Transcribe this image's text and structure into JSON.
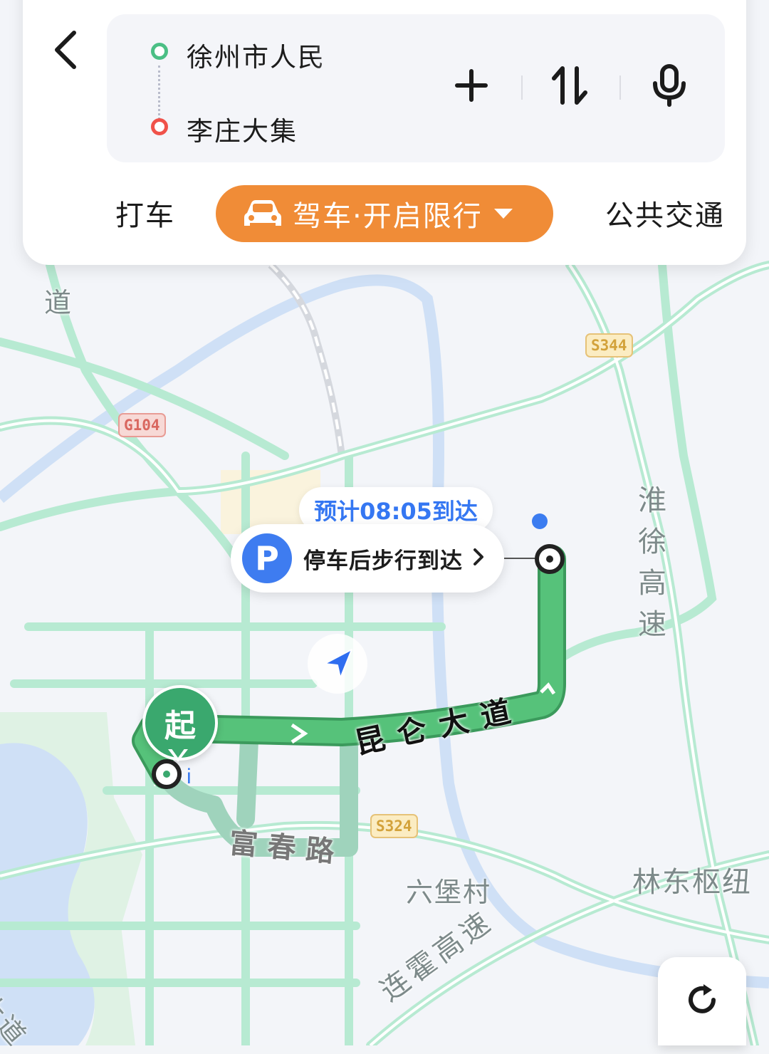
{
  "route": {
    "start": "徐州市人民",
    "end": "李庄大集"
  },
  "modes": {
    "taxi": "打车",
    "driving": "驾车·开启限行",
    "transit": "公共交通"
  },
  "icons": {
    "back": "chevron-left-icon",
    "add": "plus-icon",
    "swap": "swap-icon",
    "voice": "microphone-icon",
    "car": "car-icon",
    "dropdown": "caret-down-icon",
    "parking": "parking-icon",
    "locate": "navigation-arrow-icon",
    "refresh": "refresh-icon"
  },
  "map": {
    "eta": "预计08:05到达",
    "parking_label": "停车后步行到达",
    "parking_letter": "P",
    "start_marker": "起",
    "labels": {
      "kunlun": "昆仑大道",
      "fuchun": "富春路",
      "liubao": "六堡村",
      "huaixu": "淮徐高速",
      "lindong": "林东枢纽",
      "lianhuo": "连霍高速",
      "dao_top": "道",
      "dao_bottom": "大道"
    },
    "shields": {
      "g104": "G104",
      "s344": "S344",
      "s324": "S324"
    }
  },
  "colors": {
    "accent": "#f08c37",
    "route": "#56c27a",
    "route_alt": "#9fd3bc",
    "road": "#b7ead2",
    "water": "#cfe0f6",
    "eta": "#3577f2",
    "start_dot": "#4bbf85",
    "end_dot": "#f0524a"
  }
}
